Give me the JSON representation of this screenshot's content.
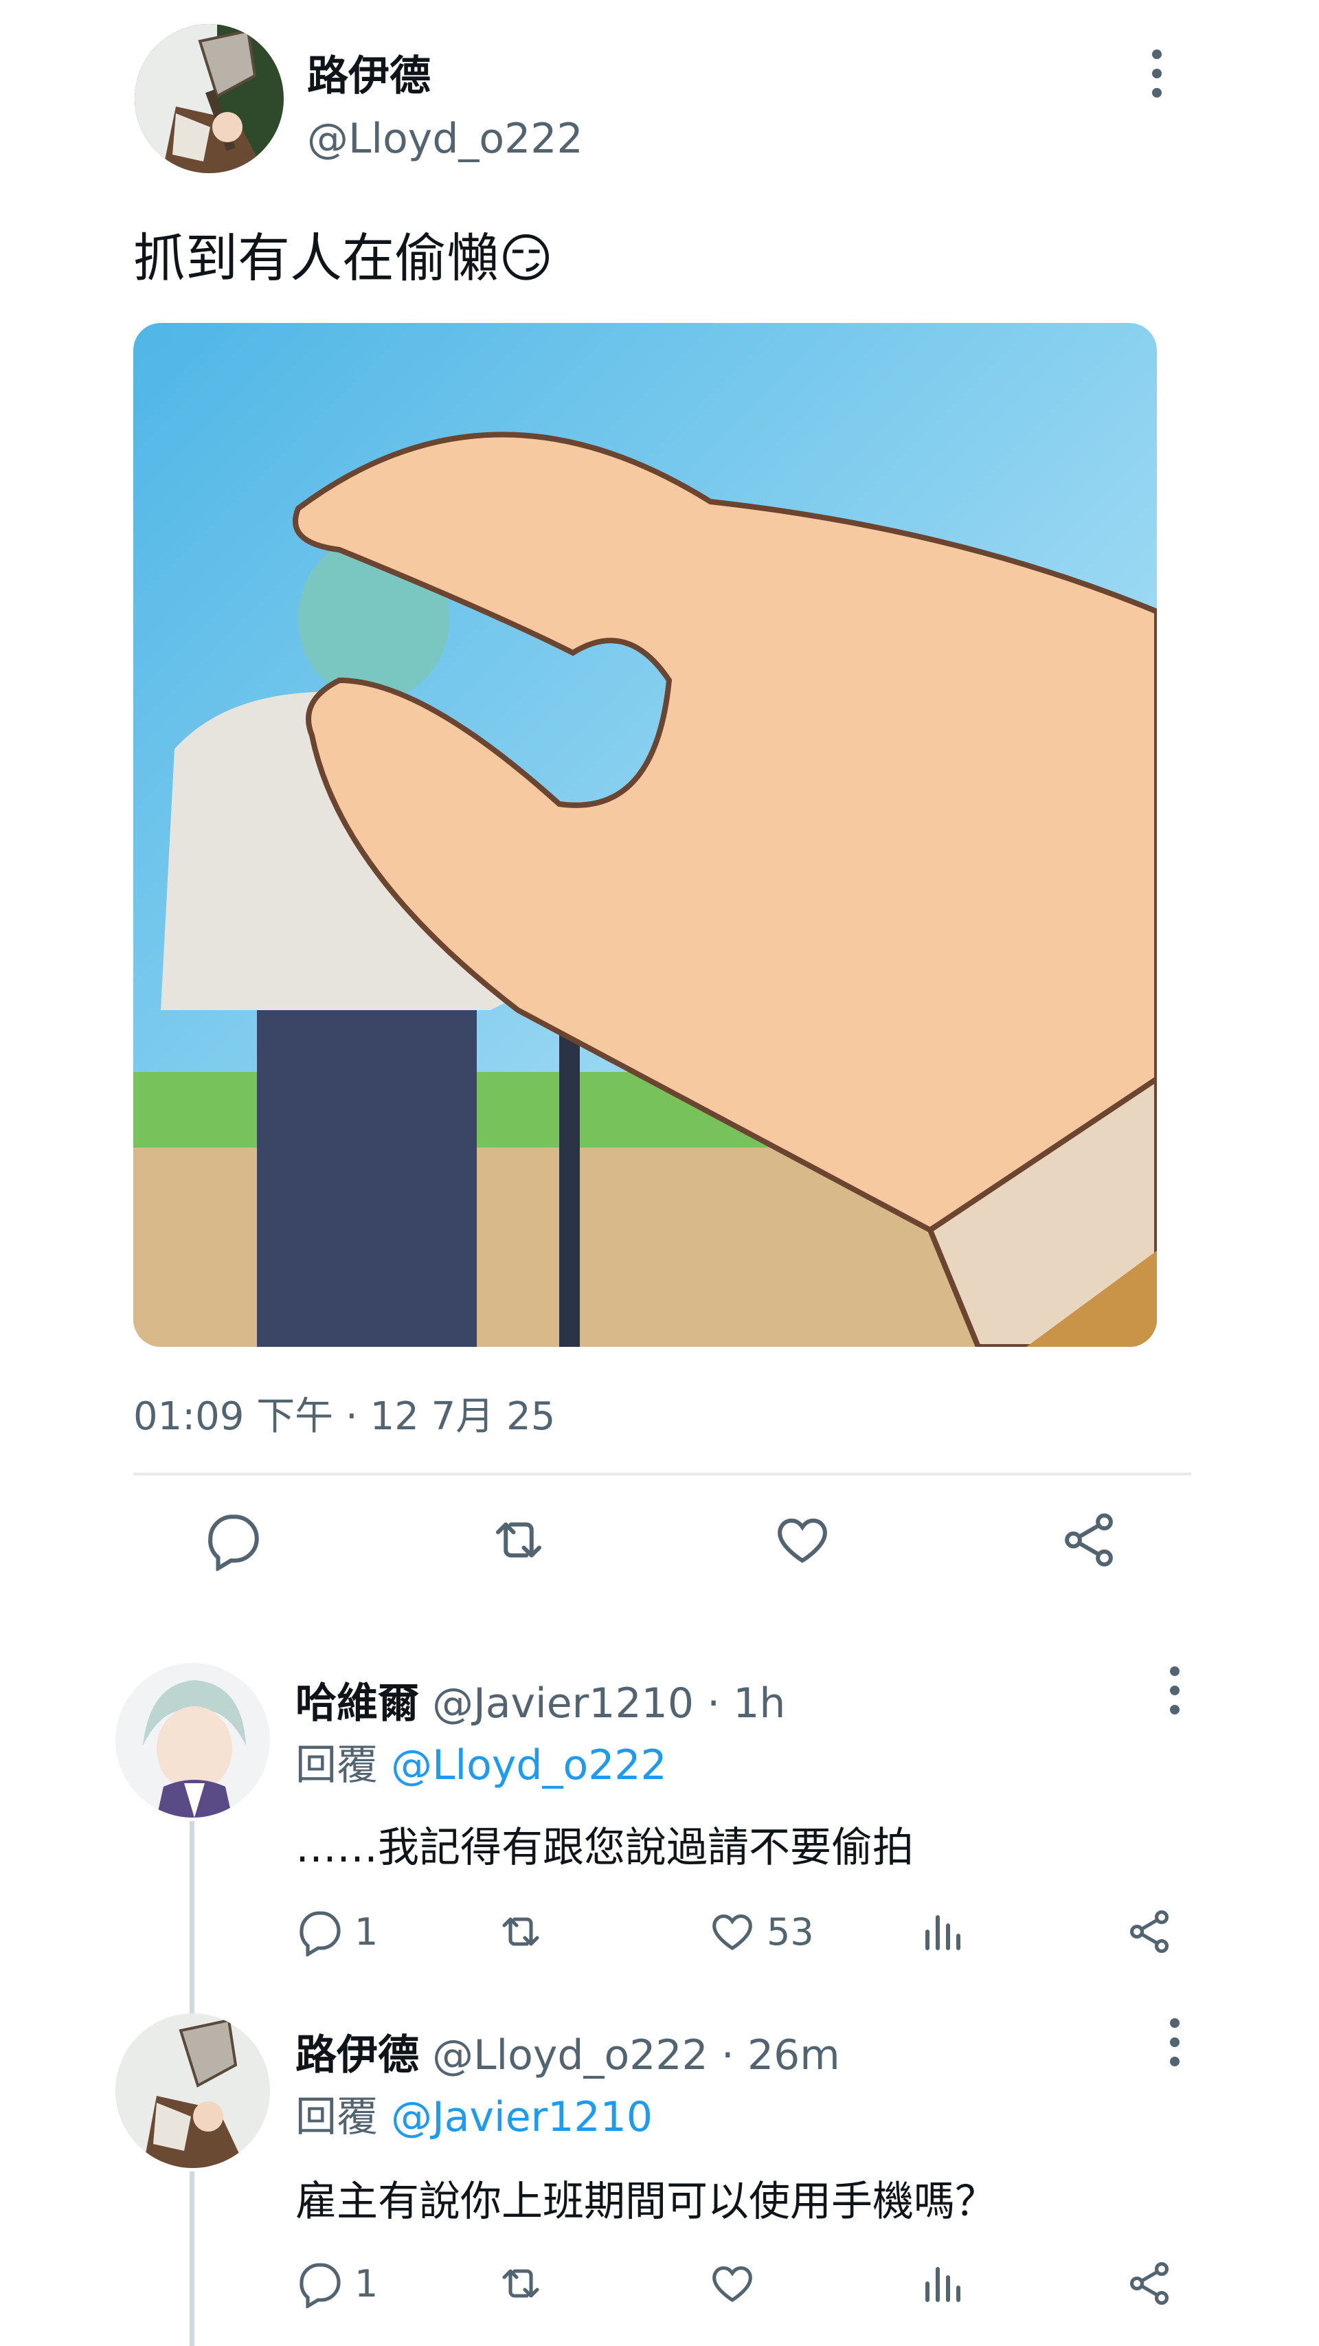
{
  "tweet": {
    "author_name": "路伊德",
    "author_handle": "@Lloyd_o222",
    "text": "抓到有人在偷懶😏",
    "timestamp": "01:09 下午 · 12 7月 25",
    "actions": [
      "reply-icon",
      "retweet-icon",
      "like-icon",
      "share-icon"
    ]
  },
  "replies": [
    {
      "name": "哈維爾",
      "handle": "@Javier1210",
      "time": "· 1h",
      "reply_label": "回覆",
      "reply_to": "@Lloyd_o222",
      "text": "……我記得有跟您說過請不要偷拍",
      "reply_count": "1",
      "retweet_count": "",
      "like_count": "53"
    },
    {
      "name": "路伊德",
      "handle": "@Lloyd_o222",
      "time": "· 26m",
      "reply_label": "回覆",
      "reply_to": "@Javier1210",
      "text": "雇主有說你上班期間可以使用手機嗎？",
      "reply_count": "1",
      "retweet_count": "",
      "like_count": ""
    }
  ],
  "colors": {
    "text": "#0f1419",
    "muted": "#536471",
    "link": "#1d9bf0",
    "divider": "#e7e9ea"
  }
}
